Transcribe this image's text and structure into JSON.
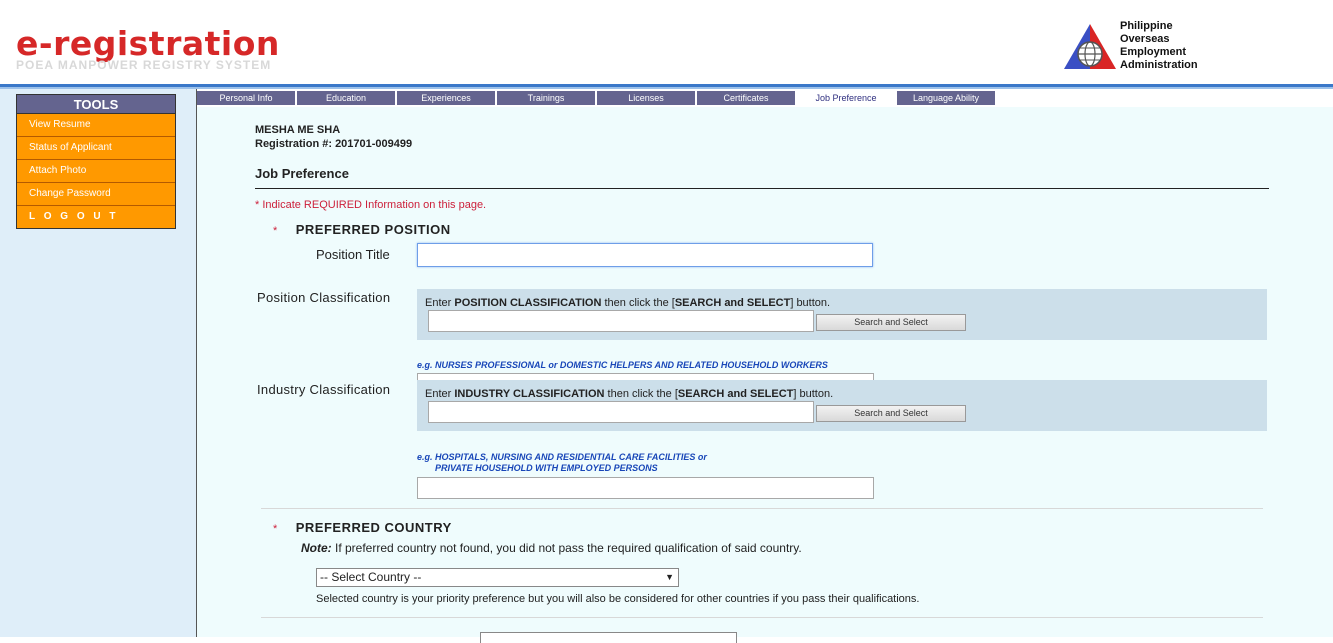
{
  "header": {
    "brand_title": "e-registration",
    "brand_subtitle": "POEA MANPOWER REGISTRY SYSTEM",
    "agency_lines": [
      "Philippine",
      "Overseas",
      "Employment",
      "Administration"
    ]
  },
  "sidebar": {
    "heading": "TOOLS",
    "items": [
      {
        "label": "View Resume"
      },
      {
        "label": "Status of Applicant"
      },
      {
        "label": "Attach Photo"
      },
      {
        "label": "Change Password"
      },
      {
        "label": "L O G O U T"
      }
    ]
  },
  "tabs": [
    {
      "label": "Personal Info",
      "active": false
    },
    {
      "label": "Education",
      "active": false
    },
    {
      "label": "Experiences",
      "active": false
    },
    {
      "label": "Trainings",
      "active": false
    },
    {
      "label": "Licenses",
      "active": false
    },
    {
      "label": "Certificates",
      "active": false
    },
    {
      "label": "Job Preference",
      "active": true
    },
    {
      "label": "Language Ability",
      "active": false
    }
  ],
  "applicant": {
    "name": "MESHA ME SHA",
    "registration": "Registration #: 201701-009499"
  },
  "page": {
    "heading": "Job Preference",
    "required_note": "*  Indicate REQUIRED Information on this page."
  },
  "preferred_position": {
    "star": "*",
    "title": "PREFERRED POSITION",
    "position_title_label": "Position Title",
    "position_title_value": "",
    "position_classification": {
      "label": "Position  Classification",
      "instr_pre": "Enter ",
      "instr_bold": "POSITION CLASSIFICATION",
      "instr_mid": " then click the [",
      "instr_btn": "SEARCH and SELECT",
      "instr_post": "] button.",
      "button": "Search and Select",
      "example_lines": [
        "e.g. NURSES PROFESSIONAL or DOMESTIC HELPERS AND RELATED HOUSEHOLD WORKERS"
      ],
      "value": ""
    },
    "industry_classification": {
      "label": "Industry Classification",
      "instr_pre": "Enter ",
      "instr_bold": "INDUSTRY CLASSIFICATION",
      "instr_mid": " then click the [",
      "instr_btn": "SEARCH and SELECT",
      "instr_post": "] button.",
      "button": "Search and Select",
      "example_lines": [
        "e.g. HOSPITALS, NURSING AND RESIDENTIAL CARE FACILITIES or",
        "PRIVATE HOUSEHOLD WITH EMPLOYED PERSONS"
      ],
      "value": ""
    }
  },
  "preferred_country": {
    "star": "*",
    "title": "PREFERRED COUNTRY",
    "note_label": "Note:",
    "note_text": " If preferred country not found, you did not pass the required qualification of said country.",
    "select_value": "-- Select Country --",
    "help": "Selected country is your priority preference but you will also be considered for other countries if you pass their qualifications."
  },
  "colors": {
    "brand_red": "#d62828",
    "tool_orange": "#ff9900",
    "tab_purple": "#64648f",
    "required_red": "#cc1f3a",
    "example_blue": "#1846b8",
    "content_bg": "#effcfd",
    "search_box_bg": "#ccdfea"
  }
}
